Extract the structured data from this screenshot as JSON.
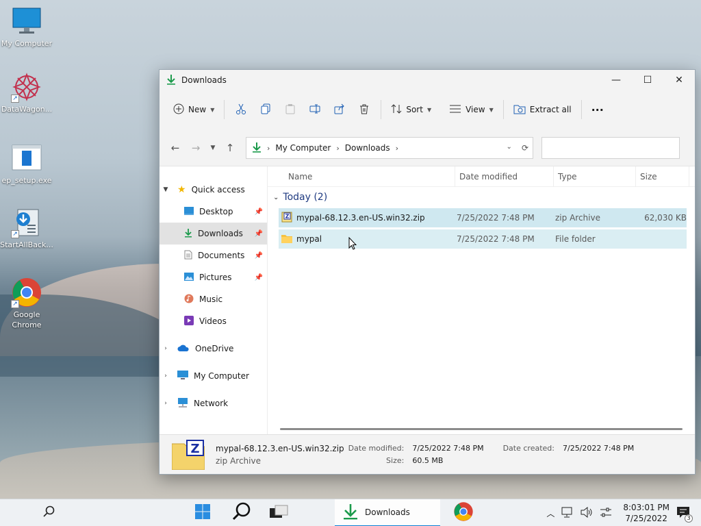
{
  "desktop": {
    "icons": [
      {
        "label": "My Computer",
        "icon": "monitor-icon"
      },
      {
        "label": "DataWagon...",
        "icon": "datawagon-icon"
      },
      {
        "label": "ep_setup.exe",
        "icon": "installer-icon"
      },
      {
        "label": "StartAllBack...",
        "icon": "startallback-icon"
      },
      {
        "label": "Google Chrome",
        "icon": "chrome-icon"
      }
    ]
  },
  "window": {
    "title": "Downloads",
    "controls": {
      "minimize": "—",
      "maximize": "☐",
      "close": "✕"
    }
  },
  "toolbar": {
    "new_label": "New",
    "sort_label": "Sort",
    "view_label": "View",
    "extract_label": "Extract all",
    "more_label": "···"
  },
  "address": {
    "crumbs": [
      "My Computer",
      "Downloads"
    ],
    "search_placeholder": ""
  },
  "navpane": {
    "quick_access": "Quick access",
    "items": [
      {
        "label": "Desktop",
        "pinned": true
      },
      {
        "label": "Downloads",
        "pinned": true,
        "selected": true
      },
      {
        "label": "Documents",
        "pinned": true
      },
      {
        "label": "Pictures",
        "pinned": true
      },
      {
        "label": "Music",
        "pinned": false
      },
      {
        "label": "Videos",
        "pinned": false
      }
    ],
    "onedrive": "OneDrive",
    "mycomputer": "My Computer",
    "network": "Network"
  },
  "columns": {
    "name": "Name",
    "date": "Date modified",
    "type": "Type",
    "size": "Size"
  },
  "group": {
    "label": "Today (2)"
  },
  "files": [
    {
      "name": "mypal-68.12.3.en-US.win32.zip",
      "date": "7/25/2022 7:48 PM",
      "type": "zip Archive",
      "size": "62,030 KB"
    },
    {
      "name": "mypal",
      "date": "7/25/2022 7:48 PM",
      "type": "File folder",
      "size": ""
    }
  ],
  "details": {
    "name": "mypal-68.12.3.en-US.win32.zip",
    "type": "zip Archive",
    "date_modified_label": "Date modified:",
    "date_modified": "7/25/2022 7:48 PM",
    "date_created_label": "Date created:",
    "date_created": "7/25/2022 7:48 PM",
    "size_label": "Size:",
    "size": "60.5 MB"
  },
  "taskbar": {
    "active_app": "Downloads",
    "time": "8:03:01 PM",
    "date": "7/25/2022",
    "notification_count": "3"
  },
  "colors": {
    "accent": "#0a7fd3",
    "selected_row": "#cfe8f0",
    "download_green": "#1b9a4b"
  }
}
